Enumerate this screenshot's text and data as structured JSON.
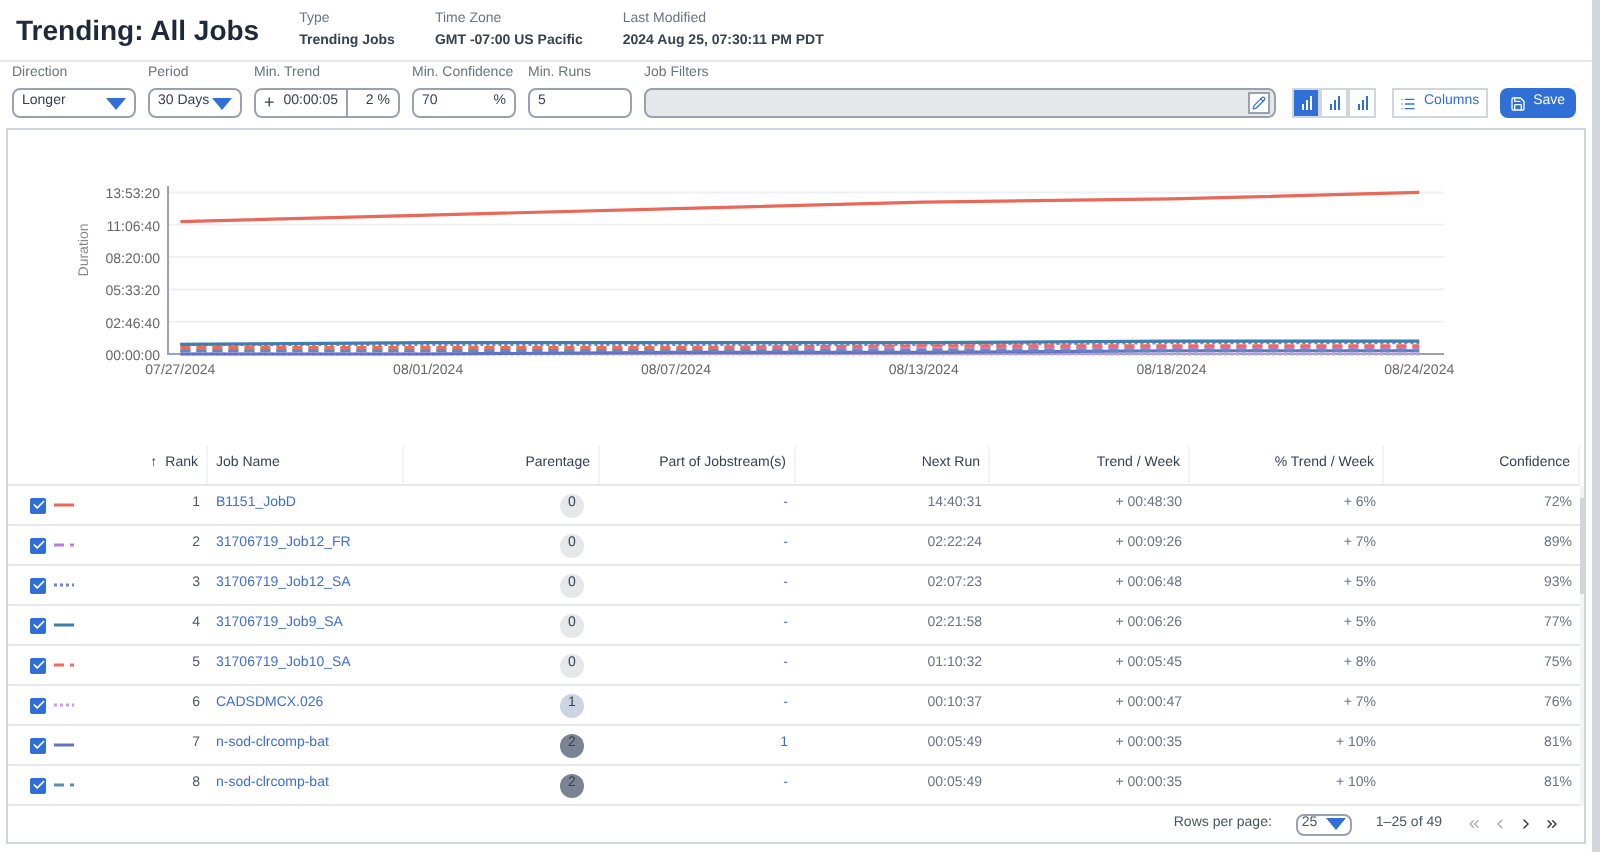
{
  "header": {
    "title": "Trending: All Jobs",
    "meta": [
      {
        "label": "Type",
        "value": "Trending Jobs"
      },
      {
        "label": "Time Zone",
        "value": "GMT -07:00 US Pacific"
      },
      {
        "label": "Last Modified",
        "value": "2024 Aug 25, 07:30:11 PM PDT"
      }
    ]
  },
  "filters": {
    "direction": {
      "label": "Direction",
      "value": "Longer"
    },
    "period": {
      "label": "Period",
      "value": "30 Days"
    },
    "min_trend": {
      "label": "Min. Trend",
      "sign": "+",
      "value": "00:00:05",
      "percent": "2",
      "unit": "%"
    },
    "min_confidence": {
      "label": "Min. Confidence",
      "value": "70",
      "unit": "%"
    },
    "min_runs": {
      "label": "Min. Runs",
      "value": "5"
    },
    "job_filters": {
      "label": "Job Filters"
    }
  },
  "toolbar": {
    "views": [
      {
        "selected": true
      },
      {
        "selected": false
      },
      {
        "selected": false
      }
    ],
    "columns": "Columns",
    "save": "Save"
  },
  "chart_data": {
    "type": "line",
    "ylabel": "Duration",
    "categories": [
      "07/27/2024",
      "08/01/2024",
      "08/07/2024",
      "08/13/2024",
      "08/18/2024",
      "08/24/2024"
    ],
    "yticks": [
      {
        "value": 0,
        "label": "00:00:00"
      },
      {
        "value": 10000,
        "label": "02:46:40"
      },
      {
        "value": 20000,
        "label": "05:33:20"
      },
      {
        "value": 30000,
        "label": "08:20:00"
      },
      {
        "value": 40000,
        "label": "11:06:40"
      },
      {
        "value": 50000,
        "label": "13:53:20"
      }
    ],
    "ylim": [
      0,
      52000
    ],
    "grid": true,
    "series": [
      {
        "color": "#e8685a",
        "line_style": "solid",
        "values": [
          41000,
          43000,
          45000,
          47000,
          48000,
          50000
        ]
      },
      {
        "color": "#b57ee0",
        "line_style": "dashed",
        "values": [
          1000,
          1000,
          1500,
          1500,
          2000,
          2000
        ]
      },
      {
        "color": "#6e86d6",
        "line_style": "dotted",
        "values": [
          3000,
          3000,
          3000,
          3000,
          3500,
          3500
        ]
      },
      {
        "color": "#3f7fb0",
        "line_style": "solid",
        "values": [
          3000,
          3500,
          3500,
          3500,
          4000,
          4000
        ]
      },
      {
        "color": "#ef6a5a",
        "line_style": "dashed",
        "values": [
          2000,
          2000,
          2000,
          2500,
          2500,
          2500
        ]
      },
      {
        "color": "#c89be6",
        "line_style": "dotted",
        "values": [
          0,
          0,
          0,
          0,
          0,
          0
        ]
      },
      {
        "color": "#6370c9",
        "line_style": "solid",
        "values": [
          0,
          0,
          500,
          500,
          1000,
          1000
        ]
      },
      {
        "color": "#5a8fb0",
        "line_style": "dashed",
        "values": [
          1000,
          1000,
          1000,
          1000,
          1000,
          1000
        ]
      }
    ]
  },
  "table": {
    "columns": [
      {
        "label": "Rank",
        "sort_icon": "↑"
      },
      {
        "label": "Job Name"
      },
      {
        "label": "Parentage"
      },
      {
        "label": "Part of Jobstream(s)"
      },
      {
        "label": "Next Run"
      },
      {
        "label": "Trend / Week"
      },
      {
        "label": "% Trend / Week"
      },
      {
        "label": "Confidence"
      }
    ],
    "rows": [
      {
        "checked": true,
        "kind": "solid",
        "color": "#e8685a",
        "rank": "1",
        "job": "B1151_JobD",
        "parentage": {
          "value": "0",
          "color": "#e5e7eb"
        },
        "jobstreams": "-",
        "next_run": "14:40:31",
        "trend": "+ 00:48:30",
        "pct": "+ 6%",
        "confidence": "72%"
      },
      {
        "checked": true,
        "kind": "dashed",
        "color": "#b57ee0",
        "rank": "2",
        "job": "31706719_Job12_FR",
        "parentage": {
          "value": "0",
          "color": "#e5e7eb"
        },
        "jobstreams": "-",
        "next_run": "02:22:24",
        "trend": "+ 00:09:26",
        "pct": "+ 7%",
        "confidence": "89%"
      },
      {
        "checked": true,
        "kind": "dotted",
        "color": "#6e86d6",
        "rank": "3",
        "job": "31706719_Job12_SA",
        "parentage": {
          "value": "0",
          "color": "#e5e7eb"
        },
        "jobstreams": "-",
        "next_run": "02:07:23",
        "trend": "+ 00:06:48",
        "pct": "+ 5%",
        "confidence": "93%"
      },
      {
        "checked": true,
        "kind": "solid",
        "color": "#3f7fb0",
        "rank": "4",
        "job": "31706719_Job9_SA",
        "parentage": {
          "value": "0",
          "color": "#e5e7eb"
        },
        "jobstreams": "-",
        "next_run": "02:21:58",
        "trend": "+ 00:06:26",
        "pct": "+ 5%",
        "confidence": "77%"
      },
      {
        "checked": true,
        "kind": "dashed",
        "color": "#ef6a5a",
        "rank": "5",
        "job": "31706719_Job10_SA",
        "parentage": {
          "value": "0",
          "color": "#e5e7eb"
        },
        "jobstreams": "-",
        "next_run": "01:10:32",
        "trend": "+ 00:05:45",
        "pct": "+ 8%",
        "confidence": "75%"
      },
      {
        "checked": true,
        "kind": "dotted",
        "color": "#c89be6",
        "rank": "6",
        "job": "CADSDMCX.026",
        "parentage": {
          "value": "1",
          "color": "#cbd5e1"
        },
        "jobstreams": "-",
        "next_run": "00:10:37",
        "trend": "+ 00:00:47",
        "pct": "+ 7%",
        "confidence": "76%"
      },
      {
        "checked": true,
        "kind": "solid",
        "color": "#6370c9",
        "rank": "7",
        "job": "n-sod-clrcomp-bat",
        "parentage": {
          "value": "2",
          "color": "#7b8494"
        },
        "jobstreams": "1",
        "next_run": "00:05:49",
        "trend": "+ 00:00:35",
        "pct": "+ 10%",
        "confidence": "81%"
      },
      {
        "checked": true,
        "kind": "dashed",
        "color": "#5a8fb0",
        "rank": "8",
        "job": "n-sod-clrcomp-bat",
        "parentage": {
          "value": "2",
          "color": "#7b8494"
        },
        "jobstreams": "-",
        "next_run": "00:05:49",
        "trend": "+ 00:00:35",
        "pct": "+ 10%",
        "confidence": "81%"
      }
    ]
  },
  "pagination": {
    "rows_label": "Rows per page:",
    "rows_value": "25",
    "range": "1–25 of 49"
  }
}
